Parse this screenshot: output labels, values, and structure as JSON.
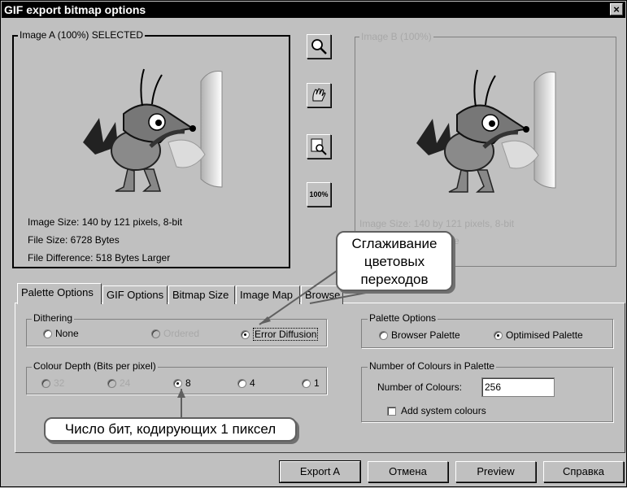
{
  "window": {
    "title": "GIF export bitmap options",
    "close_glyph": "×"
  },
  "image_a": {
    "label": "Image A (100%) SELECTED",
    "size": "Image Size: 140 by 121 pixels, 8-bit",
    "file_size": "File Size: 6728 Bytes",
    "difference": "File Difference: 518 Bytes Larger"
  },
  "image_b": {
    "label": "Image B (100%)",
    "size": "Image Size: 140 by 121 pixels, 8-bit",
    "file_size_partial": "e"
  },
  "tools": {
    "zoom100_label": "100%"
  },
  "tabs": [
    "Palette Options",
    "GIF Options",
    "Bitmap Size",
    "Image Map",
    "Browse"
  ],
  "dithering": {
    "label": "Dithering",
    "options": [
      "None",
      "Ordered",
      "Error Diffusion"
    ],
    "selected": "Error Diffusion"
  },
  "colour_depth": {
    "label": "Colour Depth (Bits per pixel)",
    "options": [
      "32",
      "24",
      "8",
      "4",
      "1"
    ],
    "selected": "8"
  },
  "palette_options": {
    "label": "Palette Options",
    "options": [
      "Browser Palette",
      "Optimised Palette"
    ],
    "selected": "Optimised Palette"
  },
  "num_colours": {
    "label": "Number of Colours in Palette",
    "field_label": "Number of Colours:",
    "value": "256",
    "add_system_label": "Add system colours"
  },
  "buttons": {
    "export": "Export A",
    "cancel": "Отмена",
    "preview": "Preview",
    "help": "Справка"
  },
  "callouts": {
    "smoothing": [
      "Сглаживание",
      "цветовых",
      "переходов"
    ],
    "bits": "Число бит, кодирующих 1 пиксел"
  },
  "colors": {
    "titlebar": "#000000",
    "face": "#c0c0c0",
    "disabled_text": "#a8a8a8"
  },
  "icons": [
    "zoom-in-icon",
    "hand-pan-icon",
    "zoom-rect-icon",
    "zoom-100-icon",
    "hedgehog-image"
  ]
}
